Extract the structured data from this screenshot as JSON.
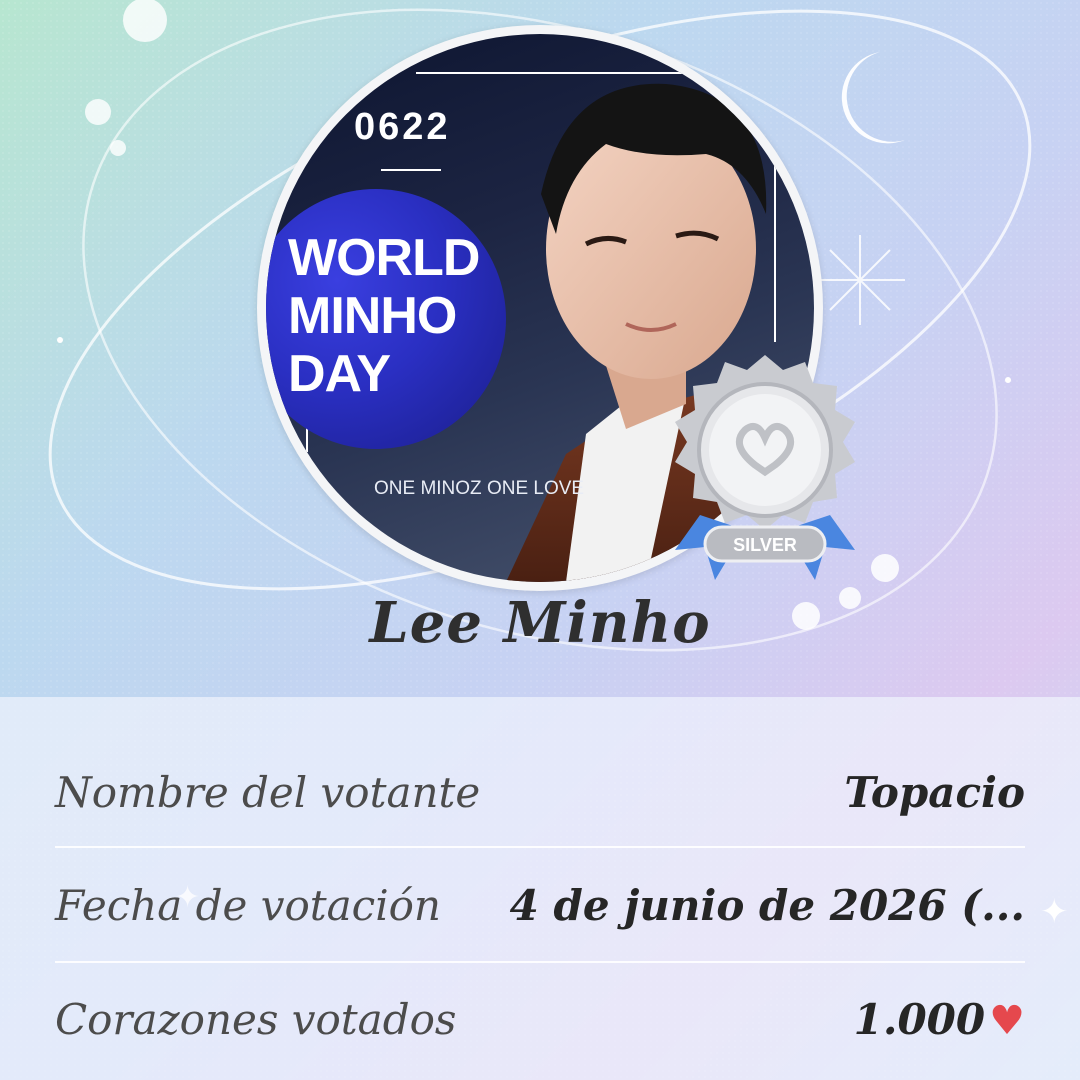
{
  "profile": {
    "name": "Lee Minho",
    "badge_label": "SILVER"
  },
  "poster": {
    "date_code": "0622",
    "title_lines": [
      "WORLD",
      "MINHO",
      "DAY"
    ],
    "tagline": "ONE MINOZ ONE LOVE"
  },
  "details": {
    "rows": [
      {
        "label": "Nombre del votante",
        "value": "Topacio"
      },
      {
        "label": "Fecha de votación",
        "value": "4 de junio de 2026 (..."
      },
      {
        "label": "Corazones votados",
        "value": "1.000",
        "icon": "heart-icon"
      }
    ]
  },
  "colors": {
    "accent_heart": "#e5484d",
    "poster_blue": "#2a2fc2",
    "badge_ribbon": "#4a86e0",
    "text_dark": "#262626"
  }
}
